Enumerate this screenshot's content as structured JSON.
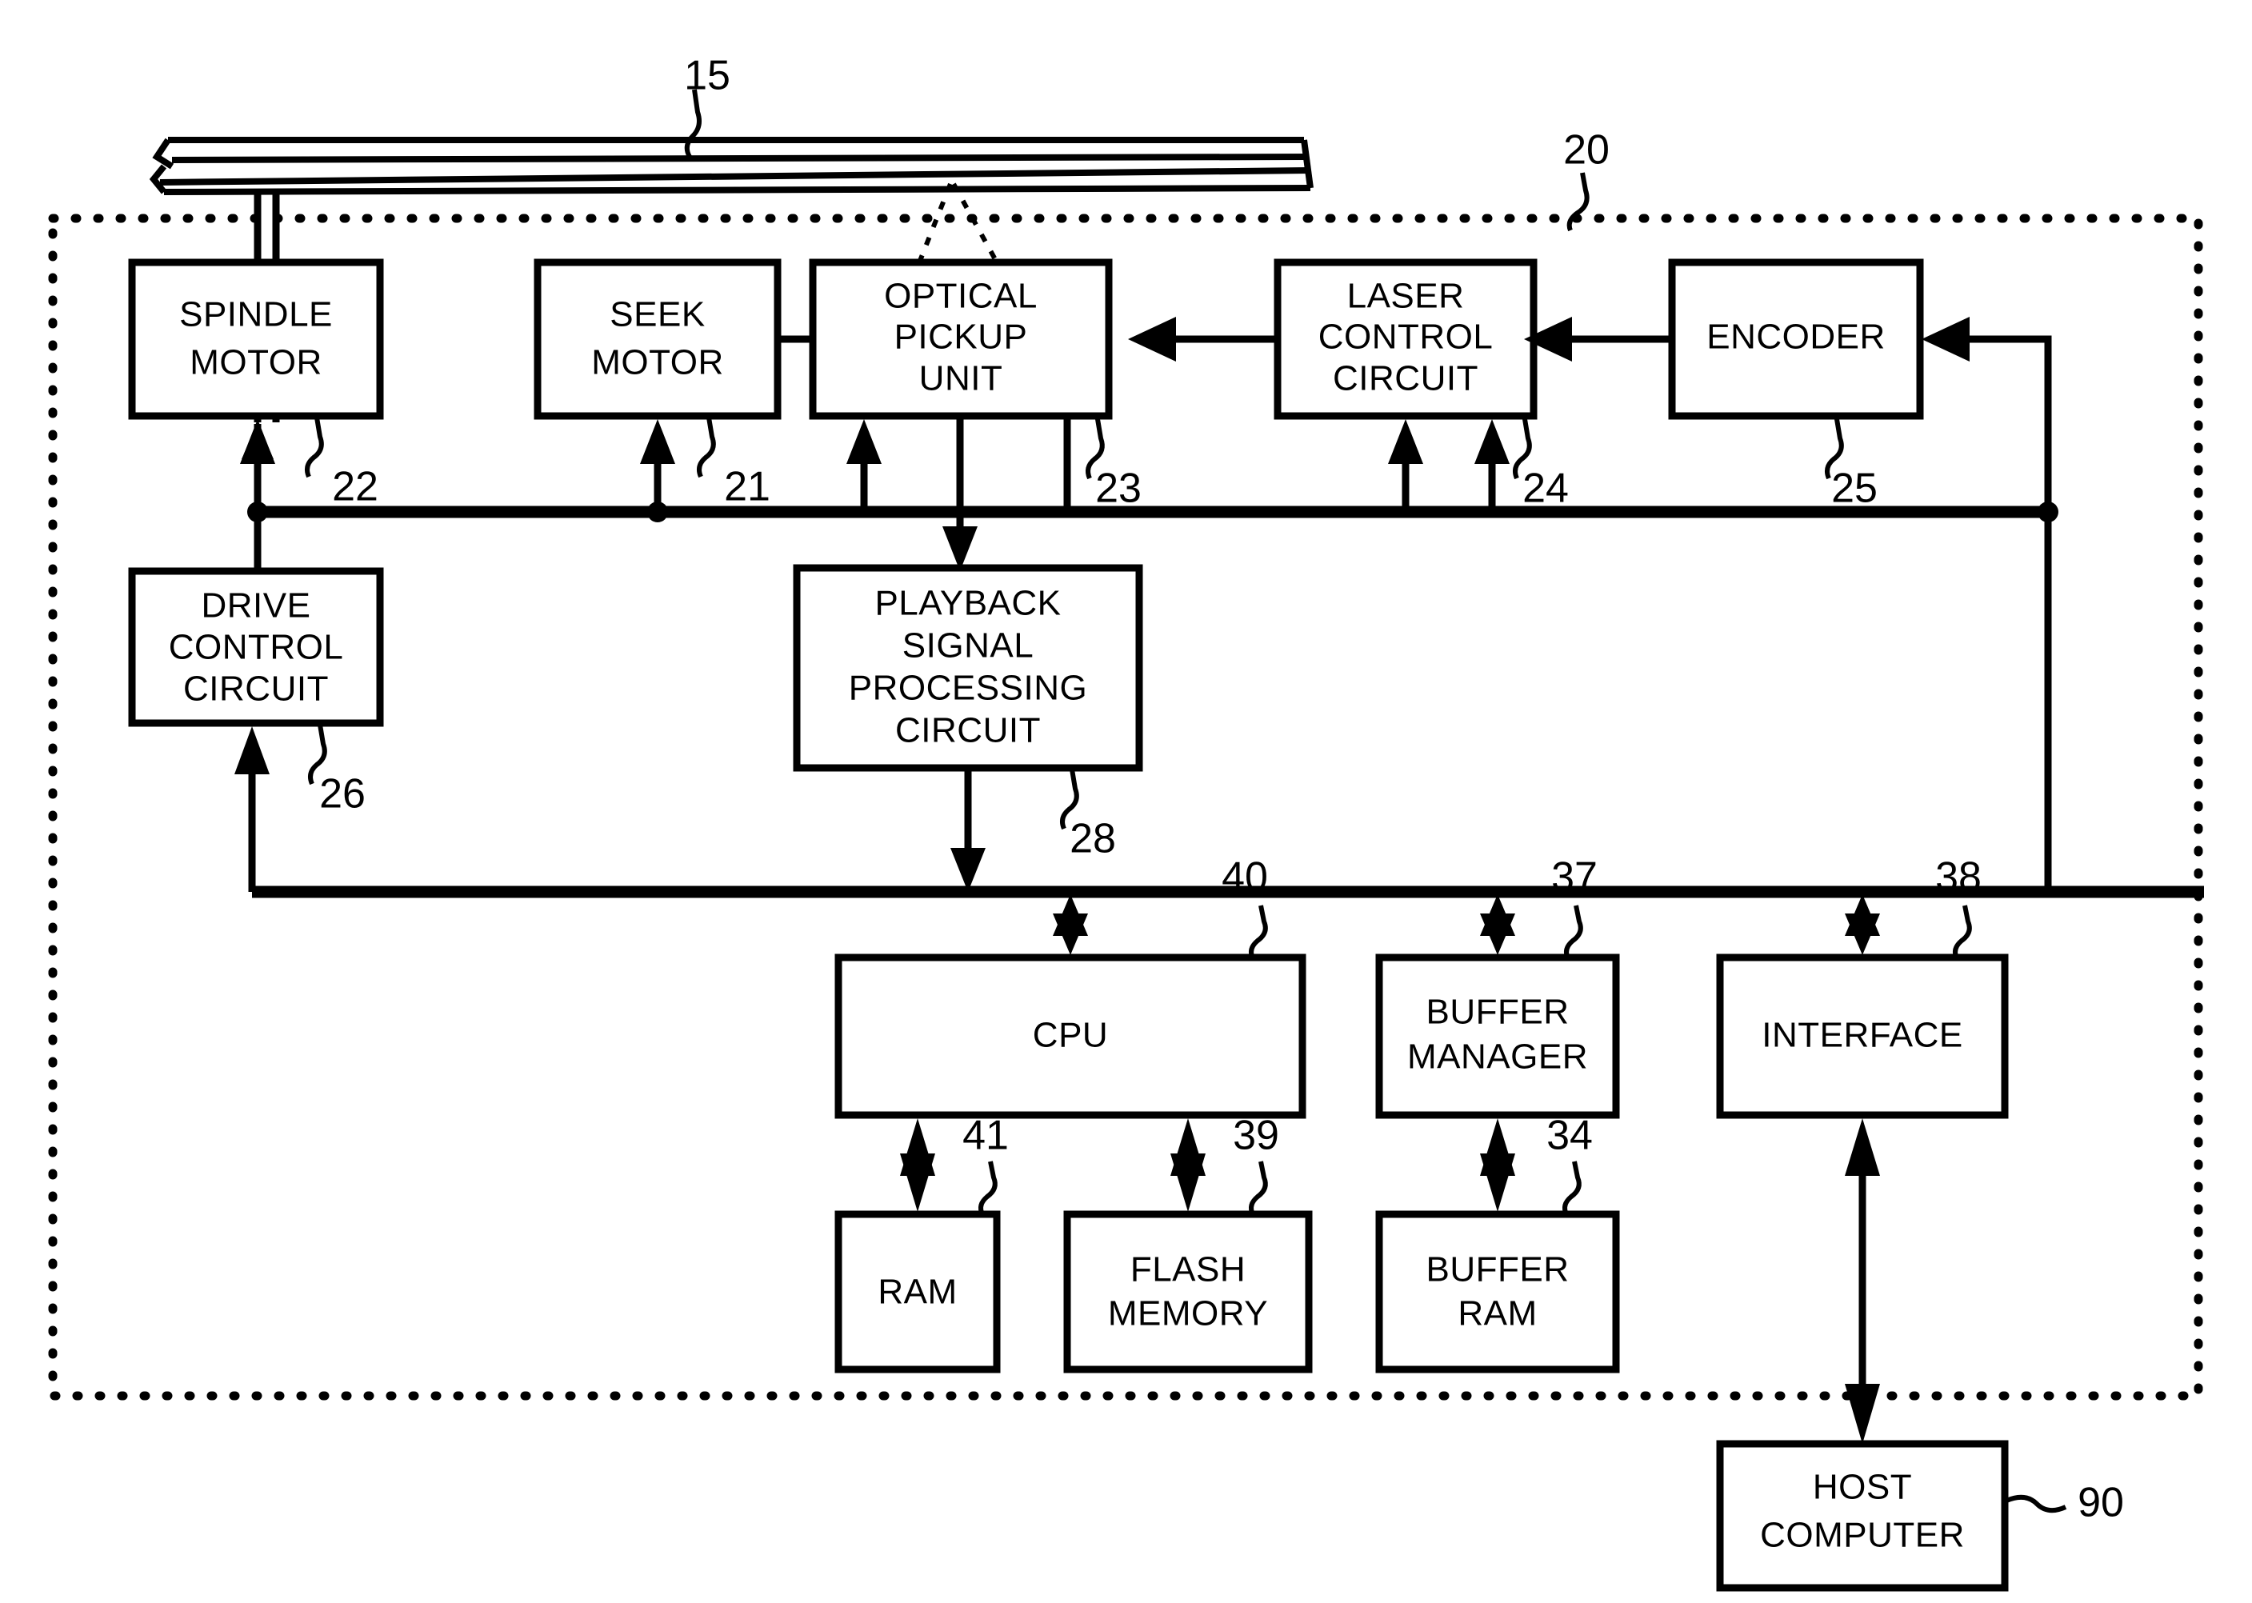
{
  "figure": {
    "title": "Optical disc drive block diagram",
    "line_color": "#000000",
    "background": "#ffffff"
  },
  "blocks": [
    {
      "id": "spindle_motor",
      "label_lines": [
        "SPINDLE",
        "MOTOR"
      ],
      "ref": "22"
    },
    {
      "id": "seek_motor",
      "label_lines": [
        "SEEK",
        "MOTOR"
      ],
      "ref": "21"
    },
    {
      "id": "optical_pickup",
      "label_lines": [
        "OPTICAL",
        "PICKUP",
        "UNIT"
      ],
      "ref": "23"
    },
    {
      "id": "laser_control",
      "label_lines": [
        "LASER",
        "CONTROL",
        "CIRCUIT"
      ],
      "ref": "24"
    },
    {
      "id": "encoder",
      "label_lines": [
        "ENCODER"
      ],
      "ref": "25"
    },
    {
      "id": "drive_control",
      "label_lines": [
        "DRIVE",
        "CONTROL",
        "CIRCUIT"
      ],
      "ref": "26"
    },
    {
      "id": "playback_signal",
      "label_lines": [
        "PLAYBACK",
        "SIGNAL",
        "PROCESSING",
        "CIRCUIT"
      ],
      "ref": "28"
    },
    {
      "id": "cpu",
      "label_lines": [
        "CPU"
      ],
      "ref": "40"
    },
    {
      "id": "buffer_manager",
      "label_lines": [
        "BUFFER",
        "MANAGER"
      ],
      "ref": "37"
    },
    {
      "id": "interface",
      "label_lines": [
        "INTERFACE"
      ],
      "ref": "38"
    },
    {
      "id": "ram",
      "label_lines": [
        "RAM"
      ],
      "ref": "41"
    },
    {
      "id": "flash_memory",
      "label_lines": [
        "FLASH",
        "MEMORY"
      ],
      "ref": "39"
    },
    {
      "id": "buffer_ram",
      "label_lines": [
        "BUFFER",
        "RAM"
      ],
      "ref": "34"
    },
    {
      "id": "host_computer",
      "label_lines": [
        "HOST",
        "COMPUTER"
      ],
      "ref": "90"
    }
  ],
  "labels": {
    "disc": "15",
    "drive_enclosure": "20",
    "spindle_motor_l1": "SPINDLE",
    "spindle_motor_l2": "MOTOR",
    "seek_motor_l1": "SEEK",
    "seek_motor_l2": "MOTOR",
    "optical_pickup_l1": "OPTICAL",
    "optical_pickup_l2": "PICKUP",
    "optical_pickup_l3": "UNIT",
    "laser_control_l1": "LASER",
    "laser_control_l2": "CONTROL",
    "laser_control_l3": "CIRCUIT",
    "encoder_l1": "ENCODER",
    "drive_control_l1": "DRIVE",
    "drive_control_l2": "CONTROL",
    "drive_control_l3": "CIRCUIT",
    "playback_l1": "PLAYBACK",
    "playback_l2": "SIGNAL",
    "playback_l3": "PROCESSING",
    "playback_l4": "CIRCUIT",
    "cpu_l1": "CPU",
    "buffer_manager_l1": "BUFFER",
    "buffer_manager_l2": "MANAGER",
    "interface_l1": "INTERFACE",
    "ram_l1": "RAM",
    "flash_l1": "FLASH",
    "flash_l2": "MEMORY",
    "buffer_ram_l1": "BUFFER",
    "buffer_ram_l2": "RAM",
    "host_l1": "HOST",
    "host_l2": "COMPUTER"
  },
  "ref_numbers": {
    "disc": "15",
    "enclosure": "20",
    "seek_motor": "21",
    "spindle_motor": "22",
    "optical_pickup": "23",
    "laser_control": "24",
    "encoder": "25",
    "drive_control": "26",
    "playback_circuit": "28",
    "buffer_ram": "34",
    "buffer_manager": "37",
    "interface": "38",
    "flash_memory": "39",
    "cpu": "40",
    "ram": "41",
    "host_computer": "90"
  }
}
